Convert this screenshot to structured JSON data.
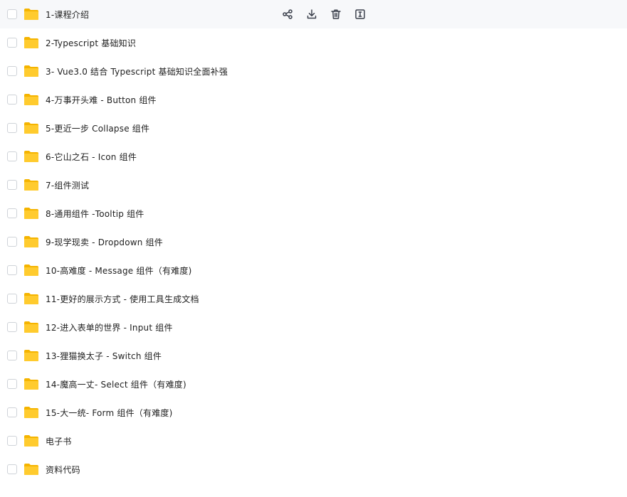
{
  "items": [
    {
      "name": "1-课程介绍"
    },
    {
      "name": "2-Typescript 基础知识"
    },
    {
      "name": "3- Vue3.0 结合 Typescript 基础知识全面补强"
    },
    {
      "name": "4-万事开头难 - Button 组件"
    },
    {
      "name": "5-更近一步 Collapse 组件"
    },
    {
      "name": "6-它山之石 - Icon 组件"
    },
    {
      "name": "7-组件测试"
    },
    {
      "name": "8-通用组件 -Tooltip 组件"
    },
    {
      "name": "9-现学现卖 - Dropdown 组件"
    },
    {
      "name": "10-高难度 - Message 组件（有难度)"
    },
    {
      "name": "11-更好的展示方式 - 使用工具生成文档"
    },
    {
      "name": "12-进入表单的世界 - Input 组件"
    },
    {
      "name": "13-狸猫换太子 - Switch 组件"
    },
    {
      "name": "14-魔高一丈- Select 组件（有难度)"
    },
    {
      "name": "15-大一统- Form 组件（有难度)"
    },
    {
      "name": "电子书"
    },
    {
      "name": "资料代码"
    }
  ],
  "hovered_row_actions": [
    "share-icon",
    "download-icon",
    "delete-icon",
    "rename-icon"
  ],
  "colors": {
    "folder_back": "#f5b400",
    "folder_front": "#ffcb2e",
    "hover_bg": "#f7f8fa",
    "icon": "#3a3f4b",
    "text": "#1f1f1f"
  }
}
